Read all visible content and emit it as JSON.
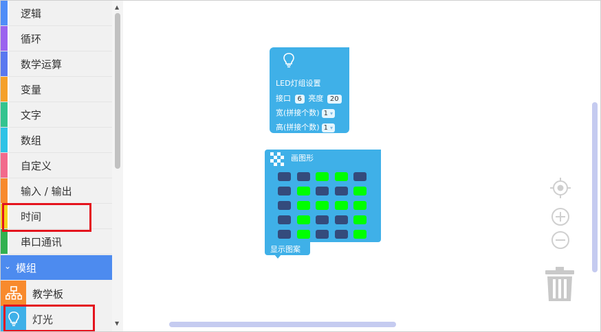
{
  "sidebar": {
    "categories": [
      {
        "label": "逻辑",
        "color": "#4f8df8"
      },
      {
        "label": "循环",
        "color": "#9b63ef"
      },
      {
        "label": "数学运算",
        "color": "#5a78f0"
      },
      {
        "label": "变量",
        "color": "#f5a02a"
      },
      {
        "label": "文字",
        "color": "#33c48f"
      },
      {
        "label": "数组",
        "color": "#2ec3e6"
      },
      {
        "label": "自定义",
        "color": "#f26a8c"
      },
      {
        "label": "输入 / 输出",
        "color": "#f88a2d"
      },
      {
        "label": "时间",
        "color": "#f5d21a"
      },
      {
        "label": "串口通讯",
        "color": "#32b150"
      }
    ],
    "group": {
      "label": "模组",
      "chevron": "⌄"
    },
    "subitems": [
      {
        "label": "教学板",
        "icon": "hierarchy-icon",
        "icon_bg": "#f88a2d"
      },
      {
        "label": "灯光",
        "icon": "lightbulb-icon",
        "icon_bg": "#3fb0e8"
      }
    ]
  },
  "blocks": {
    "led": {
      "title": "LED灯组设置",
      "port_label": "接口",
      "port_value": "6",
      "brightness_label": "亮度",
      "brightness_value": "20",
      "width_label": "宽(拼接个数)",
      "width_value": "1",
      "height_label": "高(拼接个数)",
      "height_value": "1"
    },
    "shape": {
      "title": "画图形",
      "grid": [
        [
          0,
          0,
          1,
          1,
          0
        ],
        [
          0,
          1,
          0,
          0,
          1
        ],
        [
          0,
          1,
          1,
          1,
          1
        ],
        [
          0,
          1,
          0,
          0,
          1
        ],
        [
          0,
          1,
          0,
          0,
          1
        ]
      ],
      "on_color": "#00ff00",
      "off_color": "#344b7c"
    },
    "show": {
      "label": "显示图案"
    }
  },
  "controls": {
    "recenter": "crosshair-icon",
    "zoom_in": "zoom-in-icon",
    "zoom_out": "zoom-out-icon",
    "trash": "trash-icon"
  },
  "colors": {
    "highlight": "#e4131d",
    "group_bg": "#4d8bef",
    "block": "#3fb0e8"
  }
}
